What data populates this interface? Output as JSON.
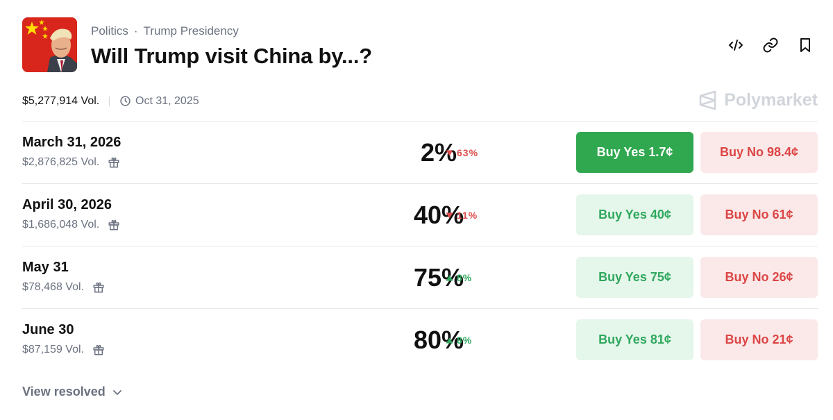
{
  "market": {
    "category": "Politics",
    "subcategory": "Trump Presidency",
    "title": "Will Trump visit China by...?",
    "total_volume": "$5,277,914 Vol.",
    "end_date": "Oct 31, 2025",
    "brand": "Polymarket"
  },
  "icons": [
    "code-embed-icon",
    "link-icon",
    "bookmark-icon",
    "clock-icon",
    "polymarket-logo-icon",
    "gift-icon",
    "chevron-down-icon"
  ],
  "colors": {
    "yes": "#2fa84f",
    "yes_light": "#e5f6ea",
    "no": "#dc4545",
    "no_light": "#fbe9e9",
    "up": "#2fa85e",
    "down": "#dc4c4c"
  },
  "outcomes": [
    {
      "date": "March 31, 2026",
      "volume": "$2,876,825 Vol.",
      "percent": "2%",
      "change": "63%",
      "direction": "down",
      "yes_label": "Buy Yes",
      "yes_price": "1.7¢",
      "no_label": "Buy No",
      "no_price": "98.4¢",
      "yes_active": true
    },
    {
      "date": "April 30, 2026",
      "volume": "$1,686,048 Vol.",
      "percent": "40%",
      "change": "11%",
      "direction": "down",
      "yes_label": "Buy Yes",
      "yes_price": "40¢",
      "no_label": "Buy No",
      "no_price": "61¢",
      "yes_active": false
    },
    {
      "date": "May 31",
      "volume": "$78,468 Vol.",
      "percent": "75%",
      "change": "8%",
      "direction": "up",
      "yes_label": "Buy Yes",
      "yes_price": "75¢",
      "no_label": "Buy No",
      "no_price": "26¢",
      "yes_active": false
    },
    {
      "date": "June 30",
      "volume": "$87,159 Vol.",
      "percent": "80%",
      "change": "8%",
      "direction": "up",
      "yes_label": "Buy Yes",
      "yes_price": "81¢",
      "no_label": "Buy No",
      "no_price": "21¢",
      "yes_active": false
    }
  ],
  "footer": {
    "view_resolved": "View resolved"
  }
}
